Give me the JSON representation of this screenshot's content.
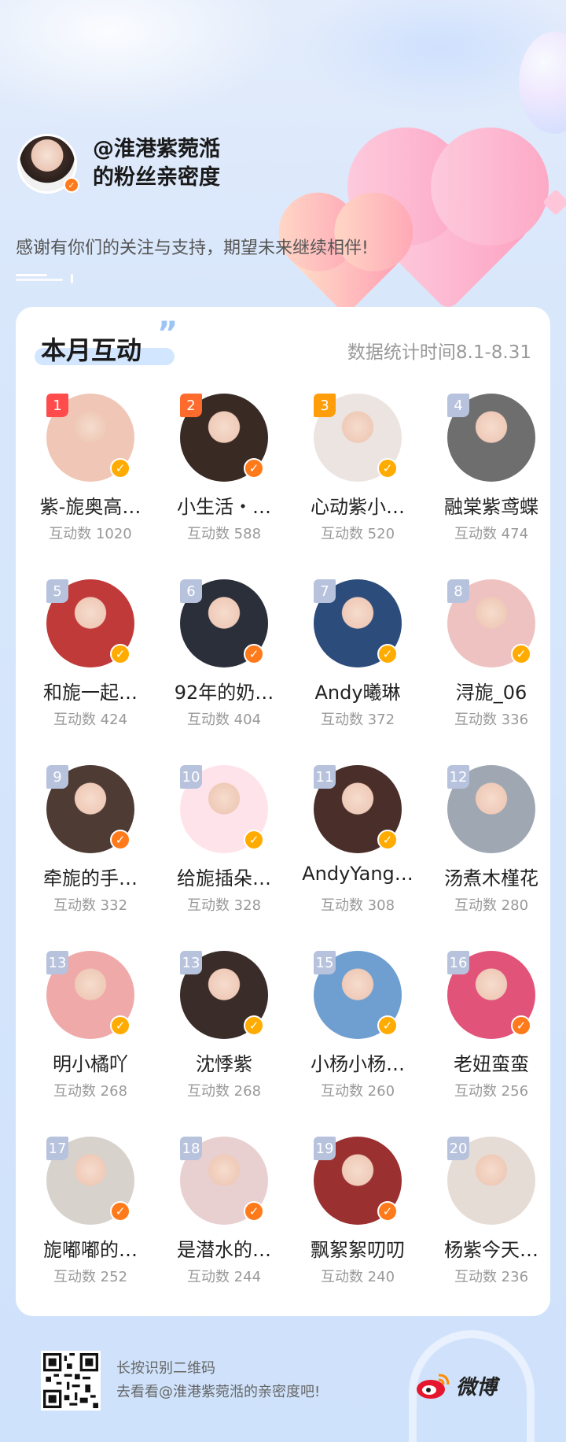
{
  "header": {
    "title_line1": "@淮港紫菀湉",
    "title_line2": "的粉丝亲密度",
    "thanks": "感谢有你们的关注与支持，期望未来继续相伴!"
  },
  "card": {
    "title": "本月互动",
    "quote": "”",
    "stat_time": "数据统计时间8.1-8.31"
  },
  "fans": [
    {
      "rank": "1",
      "name": "紫-旎奥高…",
      "count": "互动数 1020",
      "badge": "yellow",
      "avatar_color": "#f0c7b6"
    },
    {
      "rank": "2",
      "name": "小生活・…",
      "count": "互动数 588",
      "badge": "orange",
      "avatar_color": "#3a2a24"
    },
    {
      "rank": "3",
      "name": "心动紫小…",
      "count": "互动数 520",
      "badge": "yellow",
      "avatar_color": "#ece4e0"
    },
    {
      "rank": "4",
      "name": "融棠紫鸢蝶",
      "count": "互动数 474",
      "badge": "",
      "avatar_color": "#6e6e6e"
    },
    {
      "rank": "5",
      "name": "和旎一起…",
      "count": "互动数 424",
      "badge": "yellow",
      "avatar_color": "#c13a3a"
    },
    {
      "rank": "6",
      "name": "92年的奶…",
      "count": "互动数 404",
      "badge": "orange",
      "avatar_color": "#2b2f3a"
    },
    {
      "rank": "7",
      "name": "Andy曦琳",
      "count": "互动数 372",
      "badge": "yellow",
      "avatar_color": "#2c4c7c"
    },
    {
      "rank": "8",
      "name": "浔旎_06",
      "count": "互动数 336",
      "badge": "yellow",
      "avatar_color": "#efc2c2"
    },
    {
      "rank": "9",
      "name": "牵旎的手…",
      "count": "互动数 332",
      "badge": "orange",
      "avatar_color": "#4e3b34"
    },
    {
      "rank": "10",
      "name": "给旎插朵…",
      "count": "互动数 328",
      "badge": "yellow",
      "avatar_color": "#ffe3ea"
    },
    {
      "rank": "11",
      "name": "AndyYang…",
      "count": "互动数 308",
      "badge": "yellow",
      "avatar_color": "#4a2e2a"
    },
    {
      "rank": "12",
      "name": "汤煮木槿花",
      "count": "互动数 280",
      "badge": "",
      "avatar_color": "#9fa7b2"
    },
    {
      "rank": "13",
      "name": "明小橘吖",
      "count": "互动数 268",
      "badge": "yellow",
      "avatar_color": "#f0a9a9"
    },
    {
      "rank": "13",
      "name": "沈悸紫",
      "count": "互动数 268",
      "badge": "yellow",
      "avatar_color": "#3a2c28"
    },
    {
      "rank": "15",
      "name": "小杨小杨…",
      "count": "互动数 260",
      "badge": "yellow",
      "avatar_color": "#6f9fd0"
    },
    {
      "rank": "16",
      "name": "老妞蛮蛮",
      "count": "互动数 256",
      "badge": "orange",
      "avatar_color": "#e2537a"
    },
    {
      "rank": "17",
      "name": "旎嘟嘟的…",
      "count": "互动数 252",
      "badge": "orange",
      "avatar_color": "#d8d2cc"
    },
    {
      "rank": "18",
      "name": "是潜水的…",
      "count": "互动数 244",
      "badge": "orange",
      "avatar_color": "#e9d0d0"
    },
    {
      "rank": "19",
      "name": "飘絮絮叨叨",
      "count": "互动数 240",
      "badge": "orange",
      "avatar_color": "#9b3030"
    },
    {
      "rank": "20",
      "name": "杨紫今天…",
      "count": "互动数 236",
      "badge": "",
      "avatar_color": "#e6dcd6"
    }
  ],
  "footer": {
    "line1": "长按识别二维码",
    "line2": "去看看@淮港紫菀湉的亲密度吧!",
    "brand": "微博"
  },
  "colors": {
    "rank_first": "#ff4b4b",
    "rank_second": "#ff6b2c",
    "rank_third": "#ff9d0a",
    "rank_other": "#b7c2dd",
    "badge_yellow": "#ffab00",
    "badge_orange": "#ff7a1a"
  },
  "icons": {
    "verified": "verified-badge-icon",
    "weibo": "weibo-logo-icon",
    "qr": "qr-code-icon"
  }
}
